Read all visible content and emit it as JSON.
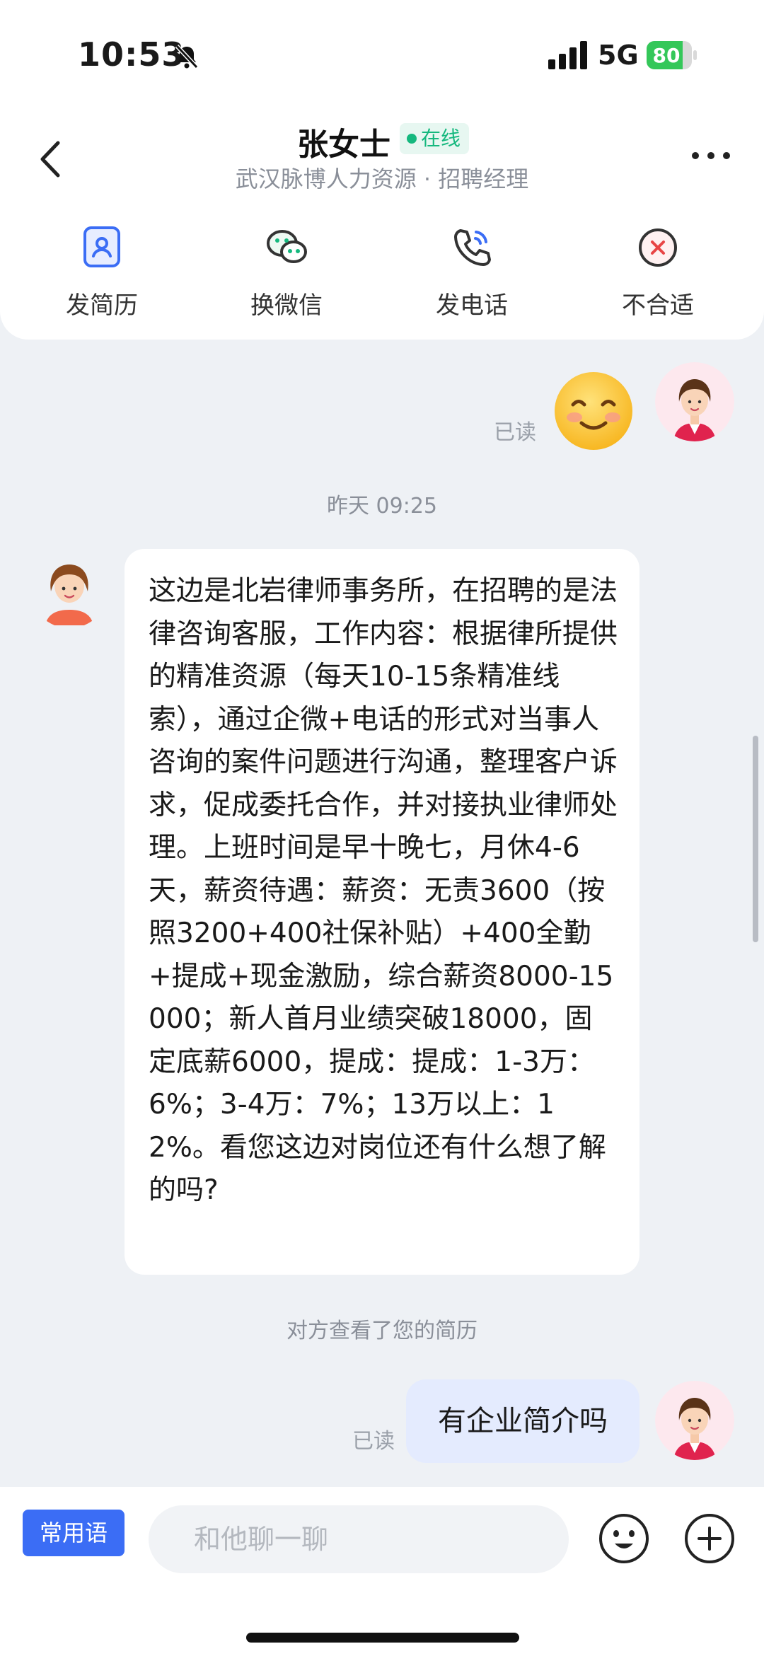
{
  "status_bar": {
    "time": "10:53",
    "network": "5G",
    "battery_percent": "80",
    "battery_level": 0.8,
    "icons": [
      "bell-slash-icon",
      "signal-icon",
      "battery-icon"
    ]
  },
  "header": {
    "name": "张女士",
    "status_badge": "在线",
    "subtitle": "武汉脉博人力资源 · 招聘经理",
    "actions": [
      {
        "label": "发简历",
        "icon": "resume-icon"
      },
      {
        "label": "换微信",
        "icon": "wechat-icon"
      },
      {
        "label": "发电话",
        "icon": "phone-icon"
      },
      {
        "label": "不合适",
        "icon": "close-circle-icon"
      }
    ]
  },
  "chat": {
    "read_label_1": "已读",
    "timestamp": "昨天 09:25",
    "incoming_message": "这边是北岩律师事务所，在招聘的是法律咨询客服，工作内容：根据律所提供的精准资源（每天10-15条精准线索），通过企微+电话的形式对当事人咨询的案件问题进行沟通，整理客户诉求，促成委托合作，并对接执业律师处理。上班时间是早十晚七，月休4-6天，薪资待遇：薪资：无责3600（按照3200+400社保补贴）+400全勤+提成+现金激励，综合薪资8000-15000；新人首月业绩突破18000，固定底薪6000，提成：提成：1-3万：6%；3-4万：7%；13万以上：12%。看您这边对岗位还有什么想了解的吗?",
    "system_note": "对方查看了您的简历",
    "read_label_2": "已读",
    "outgoing_message": "有企业简介吗"
  },
  "input_bar": {
    "phrases_label": "常用语",
    "placeholder": "和他聊一聊"
  },
  "colors": {
    "accent": "#3b6df5",
    "online": "#15b87e",
    "outgoing_bubble": "#e4ebfe",
    "background": "#eef1f5"
  }
}
